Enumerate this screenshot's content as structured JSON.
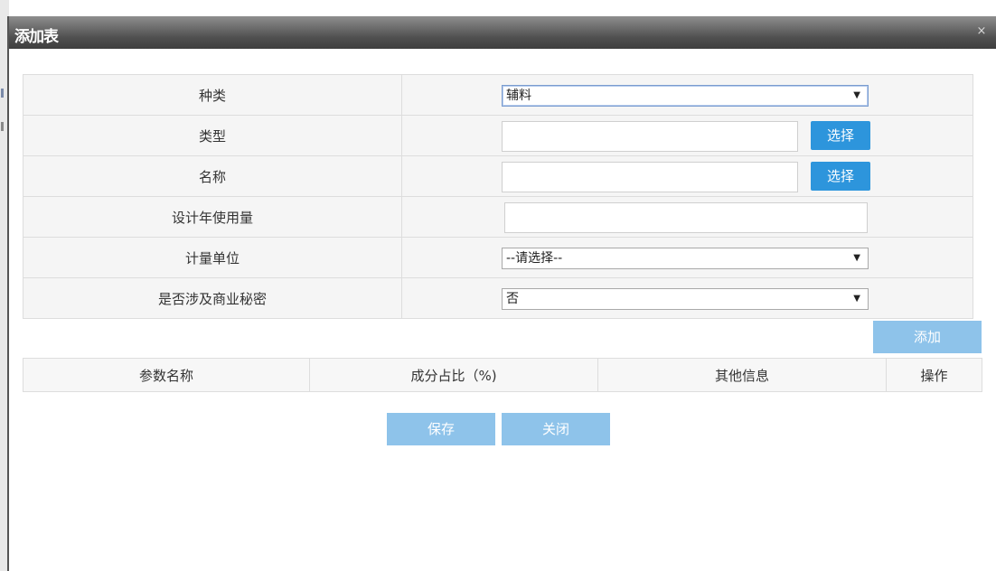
{
  "dialog": {
    "title": "添加表",
    "close_glyph": "×"
  },
  "form": {
    "rows": [
      {
        "label": "种类",
        "type": "select",
        "value": "辅料"
      },
      {
        "label": "类型",
        "type": "input-choose",
        "value": "",
        "button": "选择"
      },
      {
        "label": "名称",
        "type": "input-choose",
        "value": "",
        "button": "选择"
      },
      {
        "label": "设计年使用量",
        "type": "input",
        "value": ""
      },
      {
        "label": "计量单位",
        "type": "select",
        "value": "--请选择--"
      },
      {
        "label": "是否涉及商业秘密",
        "type": "select",
        "value": "否"
      }
    ],
    "dropdown_arrow": "▼"
  },
  "actions": {
    "add_label": "添加",
    "save_label": "保存",
    "close_label": "关闭"
  },
  "grid": {
    "columns": [
      "参数名称",
      "成分占比（%)",
      "其他信息",
      "操作"
    ]
  },
  "colors": {
    "primary_button": "#2d95dc",
    "light_button": "#8ec3ea",
    "titlebar": "#505050"
  }
}
